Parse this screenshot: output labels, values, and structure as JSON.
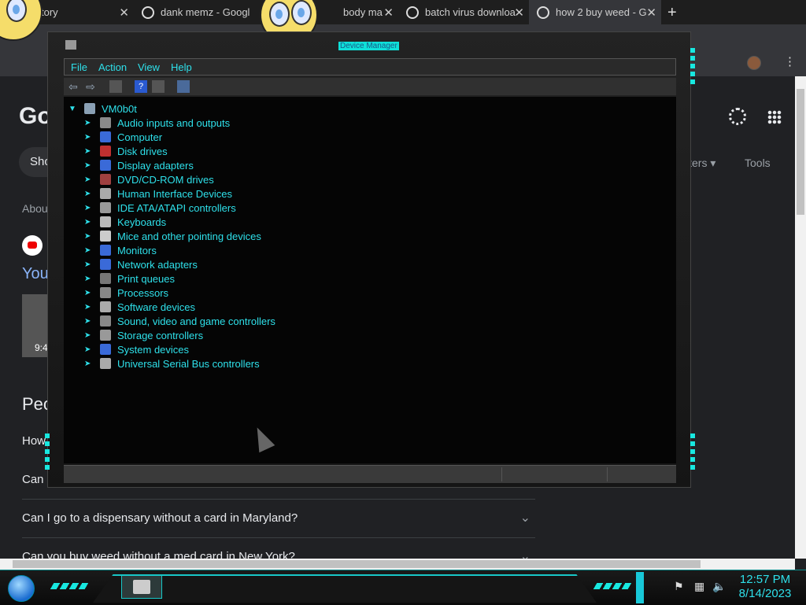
{
  "browser": {
    "tabs": [
      {
        "label": "tory",
        "active": false
      },
      {
        "label": "dank memz - Googl",
        "active": false
      },
      {
        "label": "body ma",
        "active": false
      },
      {
        "label": "batch virus downloa",
        "active": false
      },
      {
        "label": "how 2 buy weed - G",
        "active": true
      }
    ],
    "tab_close": "✕",
    "new_tab": "+",
    "menu_icon": "⋮"
  },
  "google": {
    "logo": "Go",
    "show_button": "Sho",
    "about": "Abou",
    "youtube_title": "You",
    "thumb_duration": "9:4",
    "people_heading": "Peo",
    "question_how": "How",
    "question_can": "Can",
    "questions": [
      "Can I go to a dispensary without a card in Maryland?",
      "Can you buy weed without a med card in New York?"
    ],
    "filters": "lters ▾",
    "tools": "Tools"
  },
  "device_manager": {
    "title": "Device Manager",
    "menu": [
      "File",
      "Action",
      "View",
      "Help"
    ],
    "root": "VM0b0t",
    "categories": [
      "Audio inputs and outputs",
      "Computer",
      "Disk drives",
      "Display adapters",
      "DVD/CD-ROM drives",
      "Human Interface Devices",
      "IDE ATA/ATAPI controllers",
      "Keyboards",
      "Mice and other pointing devices",
      "Monitors",
      "Network adapters",
      "Print queues",
      "Processors",
      "Software devices",
      "Sound, video and game controllers",
      "Storage controllers",
      "System devices",
      "Universal Serial Bus controllers"
    ]
  },
  "taskbar": {
    "time": "12:57 PM",
    "date": "8/14/2023"
  },
  "colors": {
    "accent_cyan": "#2ee0ea",
    "google_bg": "#202124",
    "link_blue": "#8ab4f8"
  }
}
